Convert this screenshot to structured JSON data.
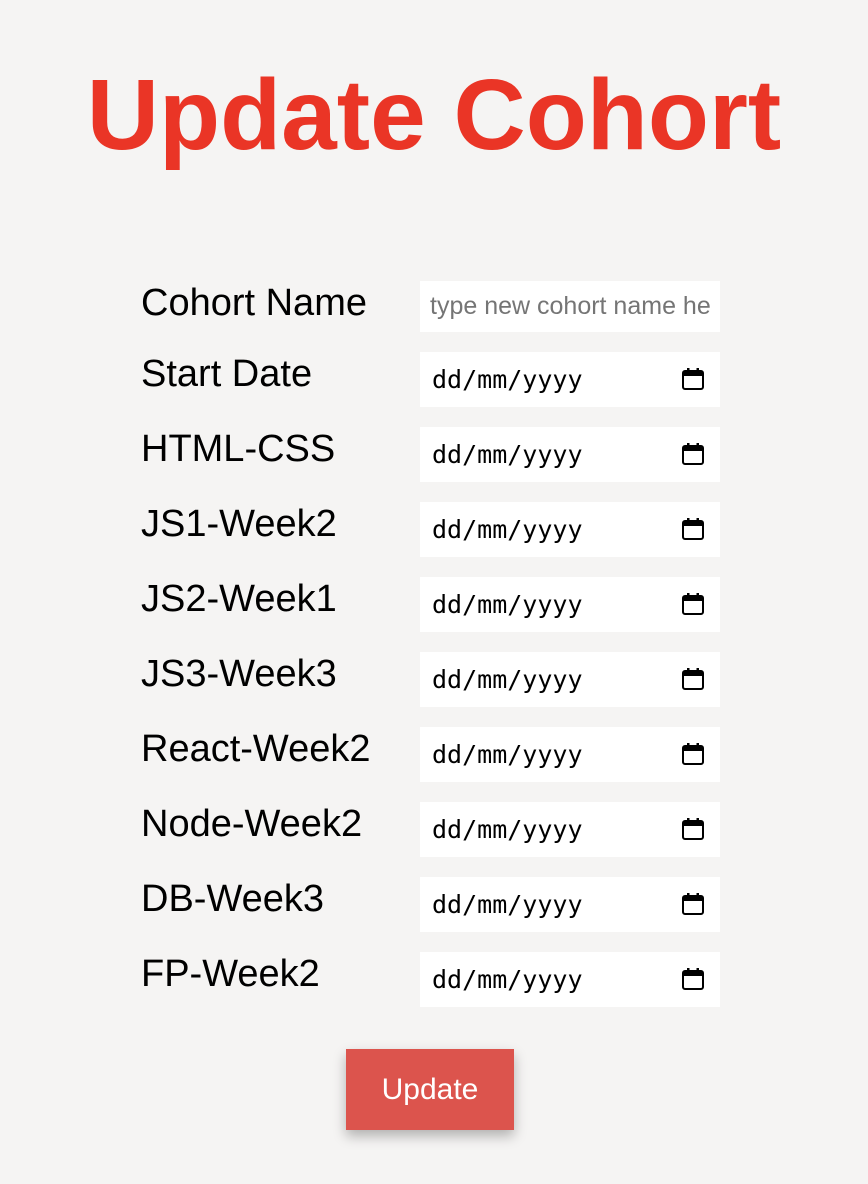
{
  "title": "Update Cohort",
  "cohort_name": {
    "label": "Cohort Name",
    "value": "",
    "placeholder": "type new cohort name here"
  },
  "date_fields": [
    {
      "label": "Start Date",
      "value": "dd/mm/yyyy"
    },
    {
      "label": "HTML-CSS",
      "value": "dd/mm/yyyy"
    },
    {
      "label": "JS1-Week2",
      "value": "dd/mm/yyyy"
    },
    {
      "label": "JS2-Week1",
      "value": "dd/mm/yyyy"
    },
    {
      "label": "JS3-Week3",
      "value": "dd/mm/yyyy"
    },
    {
      "label": "React-Week2",
      "value": "dd/mm/yyyy"
    },
    {
      "label": "Node-Week2",
      "value": "dd/mm/yyyy"
    },
    {
      "label": "DB-Week3",
      "value": "dd/mm/yyyy"
    },
    {
      "label": "FP-Week2",
      "value": "dd/mm/yyyy"
    }
  ],
  "icons": {
    "date_picker": "calendar-icon"
  },
  "submit": {
    "label": "Update"
  },
  "colors": {
    "title": "#ea3526",
    "button": "#dc544d",
    "background": "#f5f4f3"
  }
}
